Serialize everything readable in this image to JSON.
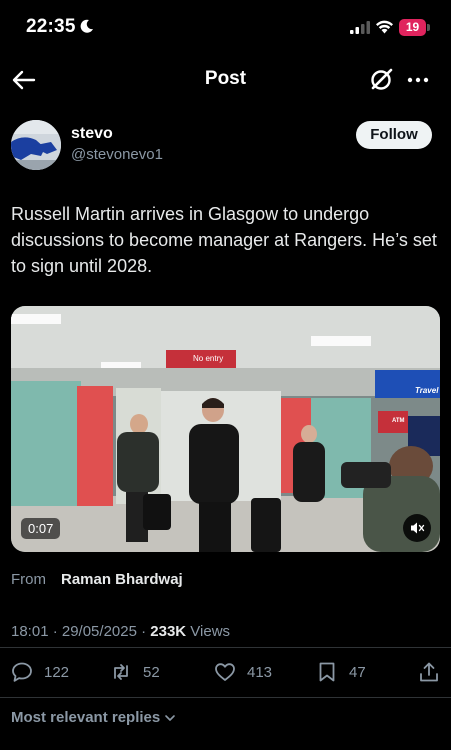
{
  "status_bar": {
    "time": "22:35",
    "battery": "19",
    "battery_color": "#e0245e"
  },
  "header": {
    "title": "Post",
    "back_icon": "arrow-left-icon",
    "grok_icon": "grok-icon",
    "more_icon": "more-horizontal-icon"
  },
  "post": {
    "author": {
      "display_name": "stevo",
      "handle": "@stevonevo1"
    },
    "follow_label": "Follow",
    "text": "Russell Martin arrives in Glasgow to undergo discussions to become manager at Rangers. He’s set to sign until 2028.",
    "video": {
      "duration": "0:07",
      "sign_text": "No entry",
      "travel_sign": "Travel",
      "atm_sign": "ATM"
    },
    "from_label": "From",
    "from_name": "Raman Bhardwaj",
    "timestamp": "18:01 · 29/05/2025 · ",
    "views_count": "233K",
    "views_label": " Views",
    "stats": {
      "replies": "122",
      "reposts": "52",
      "likes": "413",
      "bookmarks": "47"
    }
  },
  "replies_sort": "Most relevant replies",
  "colors": {
    "background": "#000000",
    "text_primary": "#e7e9ea",
    "text_secondary": "#8b98a5",
    "divider": "#2f3336"
  }
}
